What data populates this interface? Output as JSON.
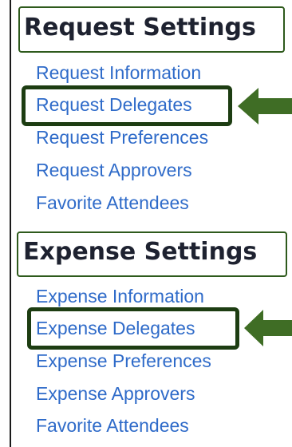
{
  "request_settings": {
    "title": "Request Settings",
    "links": [
      "Request Information",
      "Request Delegates",
      "Request Preferences",
      "Request Approvers",
      "Favorite Attendees"
    ]
  },
  "expense_settings": {
    "title": "Expense Settings",
    "links": [
      "Expense Information",
      "Expense Delegates",
      "Expense Preferences",
      "Expense Approvers",
      "Favorite Attendees"
    ]
  },
  "colors": {
    "link": "#2f6bc9",
    "heading": "#1e2230",
    "highlight": "#1d3d12",
    "arrow": "#3f6d25"
  },
  "icons": [
    "arrow-left-icon"
  ]
}
